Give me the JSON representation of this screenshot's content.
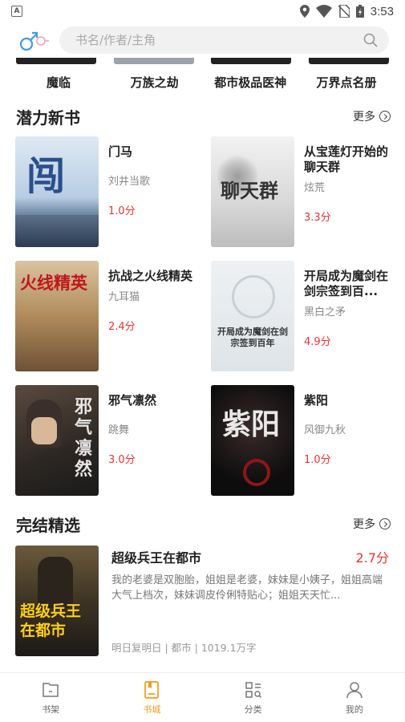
{
  "status": {
    "time": "3:53",
    "left_badge": "A"
  },
  "search": {
    "placeholder": "书名/作者/主角"
  },
  "top_books": [
    "魔临",
    "万族之劫",
    "都市极品医神",
    "万界点名册"
  ],
  "potential": {
    "title": "潜力新书",
    "more": "更多",
    "books": [
      {
        "title": "门马",
        "author": "刘井当歌",
        "score": "1.0分"
      },
      {
        "title": "从宝莲灯开始的聊天群",
        "author": "炫荒",
        "score": "3.3分"
      },
      {
        "title": "抗战之火线精英",
        "author": "九耳猫",
        "score": "2.4分"
      },
      {
        "title": "开局成为魔剑在剑宗签到百...",
        "author": "黑白之矛",
        "score": "4.9分"
      },
      {
        "title": "邪气凛然",
        "author": "跳舞",
        "score": "3.0分"
      },
      {
        "title": "紫阳",
        "author": "风御九秋",
        "score": "1.0分"
      }
    ]
  },
  "finished": {
    "title": "完结精选",
    "more": "更多",
    "book": {
      "title": "超级兵王在都市",
      "score": "2.7分",
      "desc": "我的老婆是双胞胎，姐姐是老婆，妹妹是小姨子，姐姐高端大气上档次，妹妹调皮伶俐特贴心；姐姐天天忙...",
      "meta": "明日复明日 | 都市 | 1019.1万字"
    }
  },
  "cover_text": {
    "c1": "闯",
    "c2": "聊天群",
    "c3": "火线精英",
    "c4": "开局成为魔剑在剑宗签到百年",
    "c5": "邪气凛然",
    "c6": "紫阳",
    "c7": "超级兵王在都市"
  },
  "nav": [
    {
      "label": "书架",
      "icon": "bookshelf-icon"
    },
    {
      "label": "书城",
      "icon": "bookstore-icon"
    },
    {
      "label": "分类",
      "icon": "category-icon"
    },
    {
      "label": "我的",
      "icon": "profile-icon"
    }
  ],
  "colors": {
    "accent": "#f29b12",
    "score": "#e33333",
    "search_bg": "#f1f1f1"
  }
}
